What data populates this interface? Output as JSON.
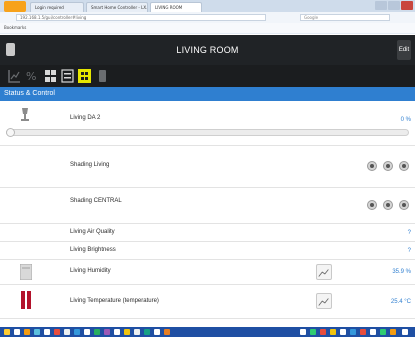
{
  "browser": {
    "tabs": [
      {
        "label": "Login required",
        "active": false
      },
      {
        "label": "Smart Home Controller - LX...",
        "active": false
      },
      {
        "label": "LIVING ROOM",
        "active": true
      }
    ],
    "address": "192.168.1.5/gui/controller#living",
    "search_placeholder": "Google",
    "bookmark_label": "Bookmarks"
  },
  "header": {
    "title": "LIVING ROOM",
    "edit_label": "Edit"
  },
  "toolbar": {
    "icons": [
      "chart-icon",
      "percent-icon",
      "grid-icon",
      "list-icon",
      "grid-selected-icon",
      "phone-icon"
    ]
  },
  "section": {
    "title": "Status & Control"
  },
  "rows": {
    "dimmer": {
      "label": "Living DA 2",
      "value": "0 %",
      "level": 0
    },
    "shading_living": {
      "label": "Shading Living"
    },
    "shading_central": {
      "label": "Shading CENTRAL"
    },
    "air_quality": {
      "label": "Living Air Quality",
      "value": "?"
    },
    "brightness": {
      "label": "Living Brightness",
      "value": "?"
    },
    "humidity": {
      "label": "Living Humidity",
      "value": "35.9 %"
    },
    "temperature": {
      "label": "Living Temperature (temperature)",
      "value": "25.4 °C"
    }
  },
  "colors": {
    "accent": "#2f7fd0",
    "header_bg": "#202326",
    "toolbar_bg": "#1b1d1f"
  }
}
